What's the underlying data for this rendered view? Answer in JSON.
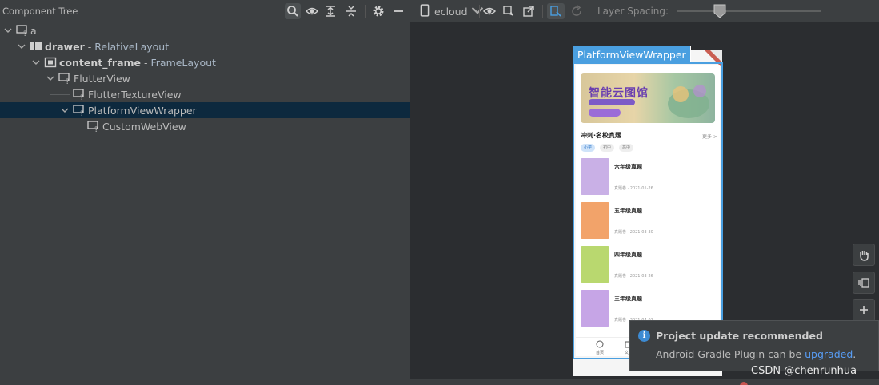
{
  "component_tree": {
    "title": "Component Tree",
    "toolbar_icons": [
      "search-icon",
      "eye-icon",
      "expand-all-icon",
      "collapse-all-icon",
      "gear-icon",
      "minimize-icon"
    ],
    "nodes": [
      {
        "id": "a",
        "label": "a",
        "type": "",
        "level": 0,
        "expanded": true,
        "icon": "view-icon",
        "bold": false
      },
      {
        "id": "drawer",
        "label": "drawer",
        "type": "RelativeLayout",
        "level": 1,
        "expanded": true,
        "icon": "relative-layout-icon",
        "bold": true
      },
      {
        "id": "content_frame",
        "label": "content_frame",
        "type": "FrameLayout",
        "level": 2,
        "expanded": true,
        "icon": "frame-layout-icon",
        "bold": true
      },
      {
        "id": "flutter_view",
        "label": "FlutterView",
        "type": "",
        "level": 3,
        "expanded": true,
        "icon": "view-icon",
        "bold": false
      },
      {
        "id": "flutter_texture",
        "label": "FlutterTextureView",
        "type": "",
        "level": 4,
        "expanded": null,
        "icon": "view-icon",
        "bold": false
      },
      {
        "id": "pvw",
        "label": "PlatformViewWrapper",
        "type": "",
        "level": 4,
        "expanded": true,
        "icon": "view-icon",
        "bold": false,
        "selected": true
      },
      {
        "id": "custom_web",
        "label": "CustomWebView",
        "type": "",
        "level": 5,
        "expanded": null,
        "icon": "view-icon",
        "bold": false
      }
    ],
    "separator": " - "
  },
  "layout_inspector": {
    "device": "ecloud",
    "layer_spacing_label": "Layer Spacing:",
    "layer_spacing_value": 0.3,
    "selected_label": "PlatformViewWrapper"
  },
  "app_preview": {
    "banner_title": "智能云图馆",
    "section_title": "冲刺·名校真题",
    "section_more": "更多 >",
    "chips": [
      "小学",
      "初中",
      "高中"
    ],
    "books": [
      {
        "name": "六年级真题",
        "meta": "真题卷 · 2021-01-26",
        "color": "#c9b0e6"
      },
      {
        "name": "五年级真题",
        "meta": "真题卷 · 2021-03-30",
        "color": "#f2a36a"
      },
      {
        "name": "四年级真题",
        "meta": "真题卷 · 2021-03-26",
        "color": "#b9d86f"
      },
      {
        "name": "三年级真题",
        "meta": "真题卷 · 2021-04-01",
        "color": "#c6a5e6"
      }
    ],
    "nav": [
      "首页",
      "文档"
    ]
  },
  "side_tools": [
    "hand-icon",
    "layers-icon",
    "zoom-in-icon"
  ],
  "notification": {
    "title": "Project update recommended",
    "body": "Android Gradle Plugin can be ",
    "link": "upgraded",
    "suffix": "."
  },
  "watermark": "CSDN @chenrunhua",
  "colors": {
    "selection": "#0d293e",
    "accent": "#4a9fe0",
    "link": "#589df6",
    "panel": "#3c3f41",
    "canvas": "#2b2d30"
  }
}
